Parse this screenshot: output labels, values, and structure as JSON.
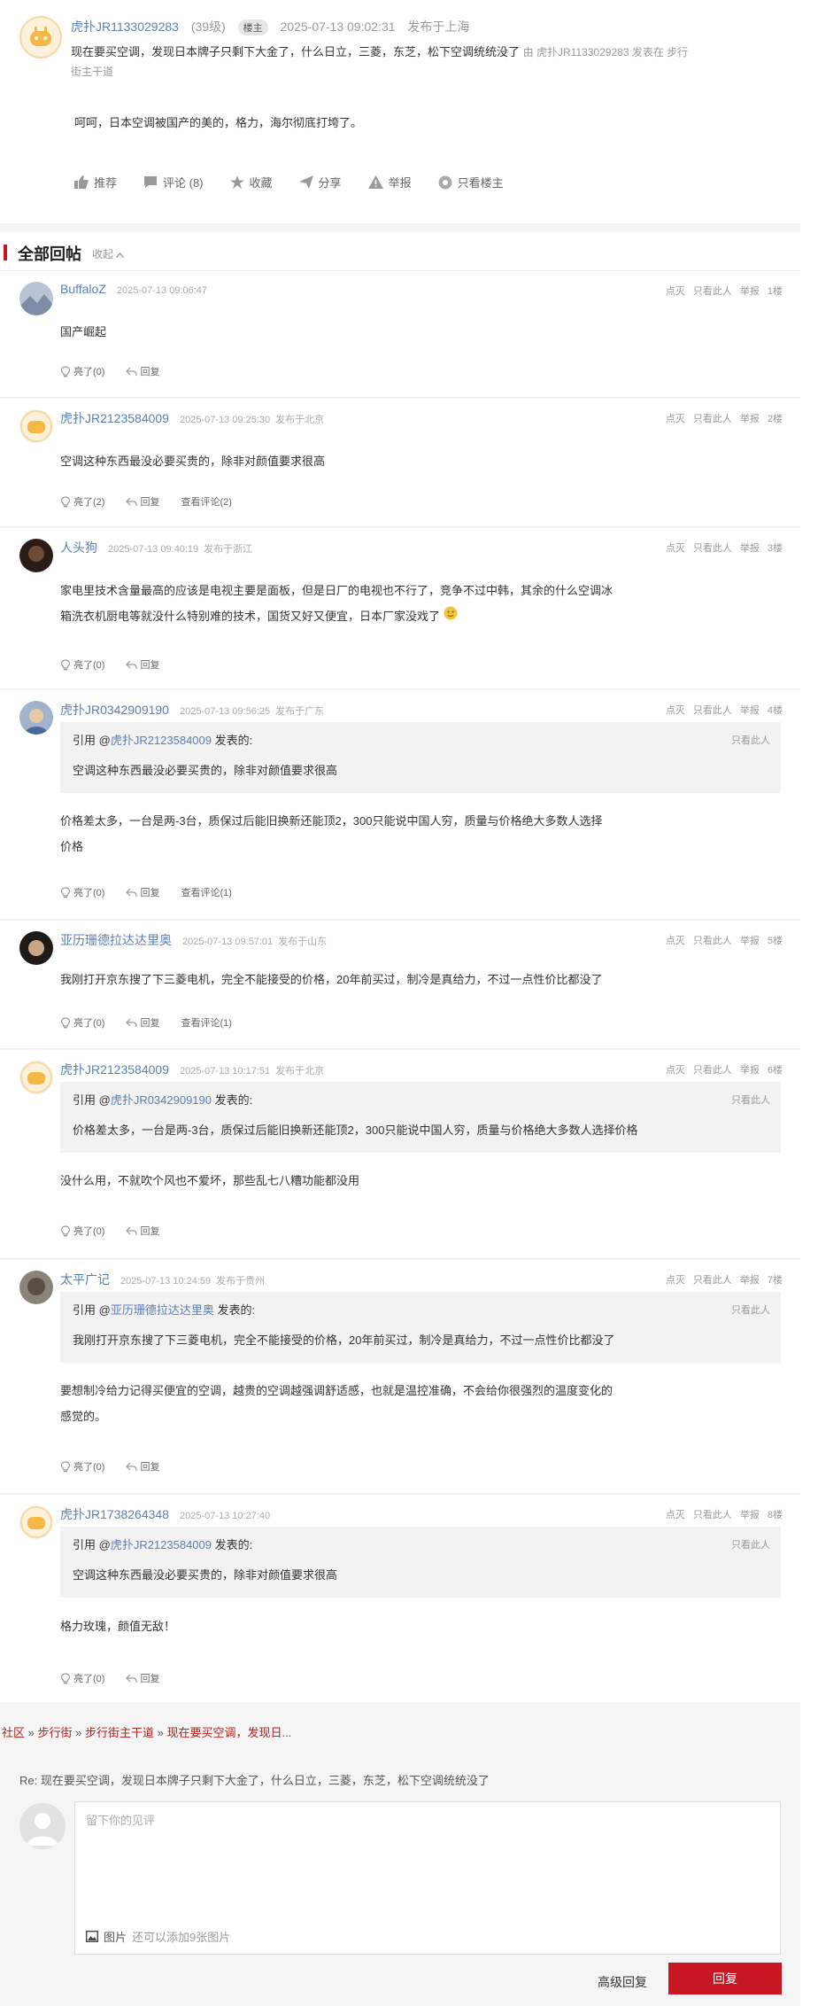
{
  "op": {
    "username": "虎扑JR1133029283",
    "level": "(39级)",
    "badge": "楼主",
    "time": "2025-07-13 09:02:31",
    "location": "发布于上海",
    "title": "现在要买空调，发现日本牌子只剩下大金了，什么日立，三菱，东芝，松下空调统统没了",
    "source_prefix": "由 虎扑JR1133029283 发表在 步行",
    "source_board": "街主干道",
    "body": "呵呵，日本空调被国产的美的，格力，海尔彻底打垮了。",
    "actions": {
      "recommend": "推荐",
      "comment": "评论 (8)",
      "favorite": "收藏",
      "share": "分享",
      "report": "举报",
      "only_op": "只看楼主"
    }
  },
  "section": {
    "title": "全部回帖",
    "collapse": "收起"
  },
  "reply_ops": {
    "dim": "点灭",
    "only_this": "只看此人",
    "report": "举报"
  },
  "quote_labels": {
    "prefix": "引用 @",
    "suffix": " 发表的:",
    "only_this": "只看此人"
  },
  "replies": [
    {
      "user": "BuffaloZ",
      "time": "2025-07-13 09:06:47",
      "location": "",
      "floor": "1楼",
      "body": [
        "国产崛起"
      ],
      "like": "亮了(0)",
      "reply": "回复",
      "comments": ""
    },
    {
      "user": "虎扑JR2123584009",
      "time": "2025-07-13 09:25:30",
      "location": "发布于北京",
      "floor": "2楼",
      "body": [
        "空调这种东西最没必要买贵的，除非对颜值要求很高"
      ],
      "like": "亮了(2)",
      "reply": "回复",
      "comments": "查看评论(2)"
    },
    {
      "user": "人头狗",
      "time": "2025-07-13 09:40:19",
      "location": "发布于浙江",
      "floor": "3楼",
      "body": [
        "家电里技术含量最高的应该是电视主要是面板，但是日厂的电视也不行了，竞争不过中韩，其余的什么空调冰",
        "箱洗衣机厨电等就没什么特别难的技术，国货又好又便宜，日本厂家没戏了"
      ],
      "like": "亮了(0)",
      "reply": "回复",
      "comments": ""
    },
    {
      "user": "虎扑JR0342909190",
      "time": "2025-07-13 09:56:25",
      "location": "发布于广东",
      "floor": "4楼",
      "quote_user": "虎扑JR2123584009",
      "quote_text": "空调这种东西最没必要买贵的，除非对颜值要求很高",
      "body": [
        "价格差太多，一台是两-3台，质保过后能旧换新还能顶2，300只能说中国人穷，质量与价格绝大多数人选择",
        "价格"
      ],
      "like": "亮了(0)",
      "reply": "回复",
      "comments": "查看评论(1)"
    },
    {
      "user": "亚历珊德拉达达里奥",
      "time": "2025-07-13 09:57:01",
      "location": "发布于山东",
      "floor": "5楼",
      "body": [
        "我刚打开京东搜了下三菱电机，完全不能接受的价格，20年前买过，制冷是真给力，不过一点性价比都没了"
      ],
      "like": "亮了(0)",
      "reply": "回复",
      "comments": "查看评论(1)"
    },
    {
      "user": "虎扑JR2123584009",
      "time": "2025-07-13 10:17:51",
      "location": "发布于北京",
      "floor": "6楼",
      "quote_user": "虎扑JR0342909190",
      "quote_text": "价格差太多，一台是两-3台，质保过后能旧换新还能顶2，300只能说中国人穷，质量与价格绝大多数人选择价格",
      "body": [
        "没什么用，不就吹个风也不爱坏，那些乱七八糟功能都没用"
      ],
      "like": "亮了(0)",
      "reply": "回复",
      "comments": ""
    },
    {
      "user": "太平广记",
      "time": "2025-07-13 10:24:59",
      "location": "发布于贵州",
      "floor": "7楼",
      "quote_user": "亚历珊德拉达达里奥",
      "quote_text": "我刚打开京东搜了下三菱电机，完全不能接受的价格，20年前买过，制冷是真给力，不过一点性价比都没了",
      "body": [
        "要想制冷给力记得买便宜的空调，越贵的空调越强调舒适感，也就是温控准确，不会给你很强烈的温度变化的",
        "感觉的。"
      ],
      "like": "亮了(0)",
      "reply": "回复",
      "comments": ""
    },
    {
      "user": "虎扑JR1738264348",
      "time": "2025-07-13 10:27:40",
      "location": "",
      "floor": "8楼",
      "quote_user": "虎扑JR2123584009",
      "quote_text": "空调这种东西最没必要买贵的，除非对颜值要求很高",
      "body": [
        "格力玫瑰，颜值无敌！"
      ],
      "like": "亮了(0)",
      "reply": "回复",
      "comments": ""
    }
  ],
  "breadcrumb": {
    "items": [
      "社区",
      "步行街",
      "步行街主干道",
      "现在要买空调，发现日..."
    ],
    "sep": " » "
  },
  "reply_box": {
    "title": "Re: 现在要买空调，发现日本牌子只剩下大金了，什么日立，三菱，东芝，松下空调统统没了",
    "placeholder": "留下你的见评",
    "pic_label": "图片",
    "pic_hint": "还可以添加9张图片",
    "advanced": "高级回复",
    "submit": "回复"
  },
  "colors": {
    "accent": "#c81623",
    "link": "#5a7fb5",
    "background": "#f5f5f5"
  }
}
